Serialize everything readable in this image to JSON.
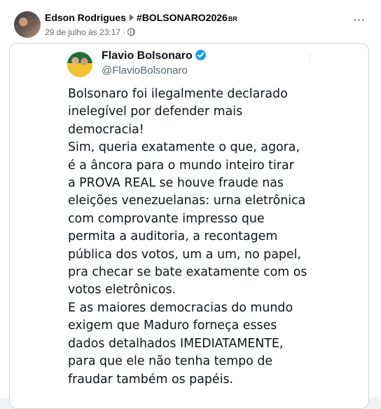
{
  "post": {
    "author": "Edson Rodrigues",
    "group": "#BOLSONARO2026",
    "group_suffix": "BR",
    "timestamp": "29 de julho às 23:17",
    "separator": "·",
    "privacy_icon": "globe-icon",
    "more_icon": "more-horizontal-icon"
  },
  "tweet": {
    "name": "Flavio Bolsonaro",
    "handle": "@FlavioBolsonaro",
    "verified_color": "#1d9bf0",
    "lines": [
      "Bolsonaro foi ilegalmente declarado",
      "inelegível por defender mais",
      "democracia!",
      "Sim, queria exatamente o que, agora,",
      "é a âncora para o mundo inteiro tirar",
      "a PROVA REAL se houve fraude nas",
      "eleições venezuelanas: urna eletrônica",
      "com comprovante impresso que",
      "permita a auditoria, a recontagem",
      "pública dos votos, um a um, no papel,",
      "pra checar se bate exatamente com os",
      "votos eletrônicos.",
      "E as maiores democracias do mundo",
      "exigem que Maduro forneça esses",
      "dados detalhados IMEDIATAMENTE,",
      "para que ele não tenha tempo de",
      "fraudar também os papéis."
    ]
  }
}
